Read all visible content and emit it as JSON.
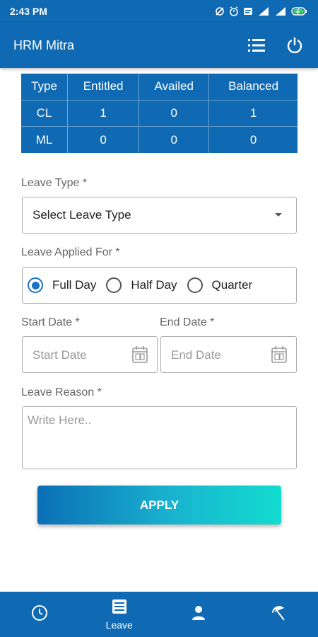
{
  "status_bar": {
    "time": "2:43 PM"
  },
  "app_bar": {
    "title": "HRM Mitra"
  },
  "leave_table": {
    "headers": [
      "Type",
      "Entitled",
      "Availed",
      "Balanced"
    ],
    "rows": [
      [
        "CL",
        "1",
        "0",
        "1"
      ],
      [
        "ML",
        "0",
        "0",
        "0"
      ]
    ]
  },
  "form": {
    "leave_type_label": "Leave Type *",
    "leave_type_value": "Select Leave Type",
    "applied_for_label": "Leave Applied For *",
    "applied_for_options": [
      "Full Day",
      "Half Day",
      "Quarter"
    ],
    "applied_for_selected": "Full Day",
    "start_date_label": "Start Date *",
    "start_date_placeholder": "Start Date",
    "end_date_label": "End Date *",
    "end_date_placeholder": "End Date",
    "reason_label": "Leave Reason *",
    "reason_placeholder": "Write Here..",
    "apply_label": "APPLY"
  },
  "bottom_nav": {
    "items": [
      {
        "icon": "clock-icon",
        "label": ""
      },
      {
        "icon": "list-icon",
        "label": "Leave"
      },
      {
        "icon": "person-icon",
        "label": ""
      },
      {
        "icon": "beach-umbrella-icon",
        "label": ""
      }
    ]
  },
  "colors": {
    "primary": "#0f6ab3",
    "radio_accent": "#1a73c7",
    "apply_gradient_start": "#0b6fb6",
    "apply_gradient_end": "#12dccf"
  }
}
